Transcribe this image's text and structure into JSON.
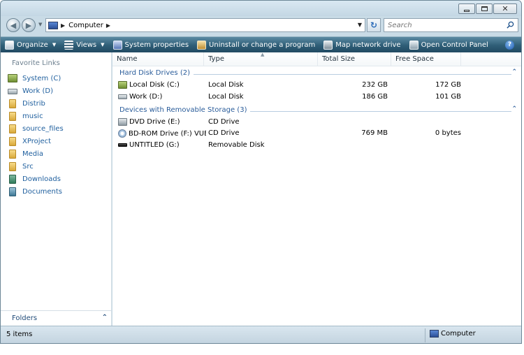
{
  "window": {
    "title": ""
  },
  "address": {
    "segments": [
      "Computer"
    ]
  },
  "search": {
    "placeholder": "Search"
  },
  "toolbar": {
    "organize": "Organize",
    "views": "Views",
    "system_properties": "System properties",
    "uninstall": "Uninstall or change a program",
    "map_drive": "Map network drive",
    "control_panel": "Open Control Panel"
  },
  "sidebar": {
    "title": "Favorite Links",
    "items": [
      {
        "label": "System (C)",
        "icon": "system-drive-icon"
      },
      {
        "label": "Work (D)",
        "icon": "drive-icon"
      },
      {
        "label": "Distrib",
        "icon": "folder-icon"
      },
      {
        "label": "music",
        "icon": "folder-icon"
      },
      {
        "label": "source_files",
        "icon": "folder-icon"
      },
      {
        "label": "XProject",
        "icon": "folder-icon"
      },
      {
        "label": "Media",
        "icon": "folder-icon"
      },
      {
        "label": "Src",
        "icon": "folder-icon"
      },
      {
        "label": "Downloads",
        "icon": "downloads-icon"
      },
      {
        "label": "Documents",
        "icon": "documents-icon"
      }
    ],
    "folders_label": "Folders"
  },
  "columns": {
    "name": "Name",
    "type": "Type",
    "total": "Total Size",
    "free": "Free Space"
  },
  "groups": [
    {
      "label": "Hard Disk Drives (2)",
      "rows": [
        {
          "name": "Local Disk (C:)",
          "type": "Local Disk",
          "total": "232 GB",
          "free": "172 GB",
          "icon": "system-disk-icon"
        },
        {
          "name": "Work (D:)",
          "type": "Local Disk",
          "total": "186 GB",
          "free": "101 GB",
          "icon": "disk-icon"
        }
      ]
    },
    {
      "label": "Devices with Removable Storage (3)",
      "rows": [
        {
          "name": "DVD Drive (E:)",
          "type": "CD Drive",
          "total": "",
          "free": "",
          "icon": "dvd-drive-icon"
        },
        {
          "name": "BD-ROM Drive (F:) VUE...",
          "type": "CD Drive",
          "total": "769 MB",
          "free": "0 bytes",
          "icon": "bd-rom-icon"
        },
        {
          "name": "UNTITLED (G:)",
          "type": "Removable Disk",
          "total": "",
          "free": "",
          "icon": "usb-drive-icon"
        }
      ]
    }
  ],
  "status": {
    "count": "5 items",
    "location": "Computer"
  },
  "colors": {
    "command_bar": "#2f5e77",
    "link": "#1f5f9e",
    "group_header": "#2a5c9a"
  }
}
